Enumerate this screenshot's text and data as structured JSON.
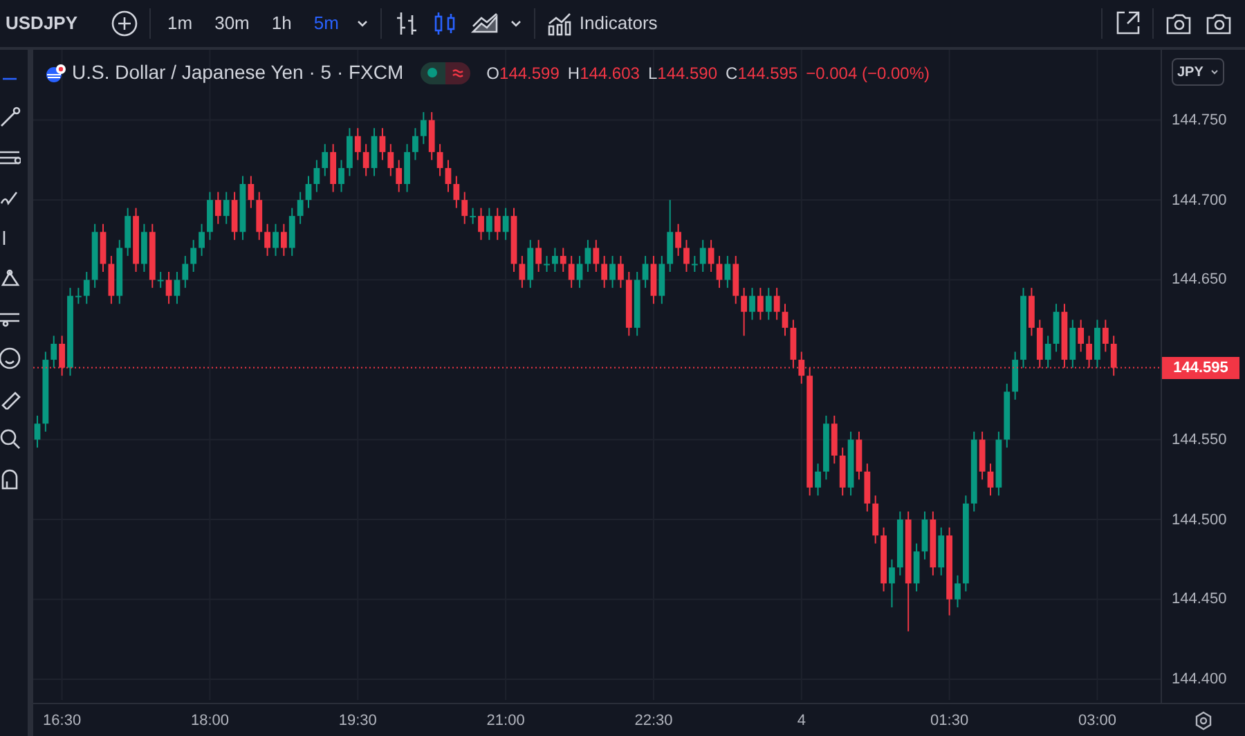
{
  "toolbar": {
    "symbol": "USDJPY",
    "intervals": [
      {
        "label": "1m",
        "selected": false
      },
      {
        "label": "30m",
        "selected": false
      },
      {
        "label": "1h",
        "selected": false
      },
      {
        "label": "5m",
        "selected": true
      }
    ],
    "chart_styles": [
      {
        "kind": "bars",
        "selected": false
      },
      {
        "kind": "candles",
        "selected": true
      },
      {
        "kind": "area",
        "selected": false
      }
    ],
    "indicators_label": "Indicators"
  },
  "legend": {
    "title": "U.S. Dollar / Japanese Yen · 5 · FXCM",
    "open_label": "O",
    "open": "144.599",
    "high_label": "H",
    "high": "144.603",
    "low_label": "L",
    "low": "144.590",
    "close_label": "C",
    "close": "144.595",
    "change": "−0.004 (−0.00%)"
  },
  "currency": "JPY",
  "next_day_time_labels": [
    "4",
    "01:30",
    "03:00"
  ],
  "last_price": "144.595",
  "chart": {
    "chart_data": {
      "type": "candlestick",
      "ylim": [
        144.387,
        144.794
      ],
      "yticks": [
        {
          "value": 144.4,
          "label": "144.400"
        },
        {
          "value": 144.45,
          "label": "144.450"
        },
        {
          "value": 144.5,
          "label": "144.500"
        },
        {
          "value": 144.55,
          "label": "144.550"
        },
        {
          "value": 144.65,
          "label": "144.650"
        },
        {
          "value": 144.7,
          "label": "144.700"
        },
        {
          "value": 144.75,
          "label": "144.750"
        }
      ],
      "grid": true,
      "ref_lines": [
        {
          "axis": "y",
          "value": 144.595,
          "color": "#f23645"
        }
      ],
      "xlim": [
        16.208,
        28.498
      ],
      "xticks": [
        {
          "value": 16.5,
          "label": "16:30"
        },
        {
          "value": 18,
          "label": "18:00"
        },
        {
          "value": 19.5,
          "label": "19:30"
        },
        {
          "value": 21,
          "label": "21:00"
        },
        {
          "value": 22.5,
          "label": "22:30"
        }
      ],
      "x": [
        16.25,
        16.3333,
        16.4167,
        16.5,
        16.5833,
        16.6667,
        16.75,
        16.8333,
        16.9167,
        17,
        17.0833,
        17.1667,
        17.25,
        17.3333,
        17.4167,
        17.5,
        17.5833,
        17.6667,
        17.75,
        17.8333,
        17.9167,
        18,
        18.0833,
        18.1667,
        18.25,
        18.3333,
        18.4167,
        18.5,
        18.5833,
        18.6667,
        18.75,
        18.8333,
        18.9167,
        19,
        19.0833,
        19.1667,
        19.25,
        19.3333,
        19.4167,
        19.5,
        19.5833,
        19.6667,
        19.75,
        19.8333,
        19.9167,
        20,
        20.0833,
        20.1667,
        20.25,
        20.3333,
        20.4167,
        20.5,
        20.5833,
        20.6667,
        20.75,
        20.8333,
        20.9167,
        21,
        21.0833,
        21.1667,
        21.25,
        21.3333,
        21.4167,
        21.5,
        21.5833,
        21.6667,
        21.75,
        21.8333,
        21.9167,
        22,
        22.0833,
        22.1667,
        22.25,
        22.3333,
        22.4167,
        22.5,
        22.5833,
        22.6667,
        22.75,
        22.8333,
        22.9167,
        23,
        23.0833,
        23.1667,
        23.25,
        23.3333,
        23.4167,
        23.5,
        23.5833,
        23.6667,
        23.75,
        23.8333,
        23.9167,
        24,
        24.0833,
        24.1667,
        24.25,
        24.3333,
        24.4167,
        24.5,
        24.5833,
        24.6667,
        24.75,
        24.8333,
        24.9167,
        25,
        25.0833,
        25.1667,
        25.25,
        25.3333,
        25.4167,
        25.5,
        25.5833,
        25.6667,
        25.75,
        25.8333,
        25.9167,
        26,
        26.0833,
        26.1667,
        26.25,
        26.3333,
        26.4167,
        26.5,
        26.5833,
        26.6667,
        26.75,
        26.8333,
        26.9167,
        27,
        27.0833,
        27.1667
      ],
      "ohlc": [
        [
          144.55,
          144.565,
          144.545,
          144.56
        ],
        [
          144.56,
          144.605,
          144.555,
          144.6
        ],
        [
          144.6,
          144.615,
          144.595,
          144.61
        ],
        [
          144.61,
          144.615,
          144.59,
          144.595
        ],
        [
          144.595,
          144.645,
          144.59,
          144.64
        ],
        [
          144.64,
          144.645,
          144.635,
          144.64
        ],
        [
          144.64,
          144.655,
          144.635,
          144.65
        ],
        [
          144.65,
          144.685,
          144.645,
          144.68
        ],
        [
          144.68,
          144.685,
          144.655,
          144.66
        ],
        [
          144.66,
          144.665,
          144.635,
          144.64
        ],
        [
          144.64,
          144.675,
          144.635,
          144.67
        ],
        [
          144.67,
          144.695,
          144.665,
          144.69
        ],
        [
          144.69,
          144.695,
          144.655,
          144.66
        ],
        [
          144.66,
          144.685,
          144.655,
          144.68
        ],
        [
          144.68,
          144.685,
          144.645,
          144.65
        ],
        [
          144.65,
          144.655,
          144.645,
          144.65
        ],
        [
          144.65,
          144.655,
          144.635,
          144.64
        ],
        [
          144.64,
          144.655,
          144.635,
          144.65
        ],
        [
          144.65,
          144.665,
          144.645,
          144.66
        ],
        [
          144.66,
          144.675,
          144.655,
          144.67
        ],
        [
          144.67,
          144.685,
          144.665,
          144.68
        ],
        [
          144.68,
          144.705,
          144.675,
          144.7
        ],
        [
          144.7,
          144.705,
          144.685,
          144.69
        ],
        [
          144.69,
          144.705,
          144.685,
          144.7
        ],
        [
          144.7,
          144.705,
          144.675,
          144.68
        ],
        [
          144.68,
          144.715,
          144.675,
          144.71
        ],
        [
          144.71,
          144.715,
          144.695,
          144.7
        ],
        [
          144.7,
          144.705,
          144.675,
          144.68
        ],
        [
          144.68,
          144.685,
          144.665,
          144.67
        ],
        [
          144.67,
          144.685,
          144.665,
          144.68
        ],
        [
          144.68,
          144.685,
          144.665,
          144.67
        ],
        [
          144.67,
          144.695,
          144.665,
          144.69
        ],
        [
          144.69,
          144.705,
          144.685,
          144.7
        ],
        [
          144.7,
          144.715,
          144.695,
          144.71
        ],
        [
          144.71,
          144.725,
          144.705,
          144.72
        ],
        [
          144.72,
          144.735,
          144.715,
          144.73
        ],
        [
          144.73,
          144.735,
          144.705,
          144.71
        ],
        [
          144.71,
          144.725,
          144.705,
          144.72
        ],
        [
          144.72,
          144.745,
          144.715,
          144.74
        ],
        [
          144.74,
          144.745,
          144.725,
          144.73
        ],
        [
          144.73,
          144.735,
          144.715,
          144.72
        ],
        [
          144.72,
          144.745,
          144.715,
          144.74
        ],
        [
          144.74,
          144.745,
          144.725,
          144.73
        ],
        [
          144.73,
          144.735,
          144.715,
          144.72
        ],
        [
          144.72,
          144.725,
          144.705,
          144.71
        ],
        [
          144.71,
          144.735,
          144.705,
          144.73
        ],
        [
          144.73,
          144.745,
          144.725,
          144.74
        ],
        [
          144.74,
          144.755,
          144.735,
          144.75
        ],
        [
          144.75,
          144.755,
          144.725,
          144.73
        ],
        [
          144.73,
          144.735,
          144.715,
          144.72
        ],
        [
          144.72,
          144.725,
          144.705,
          144.71
        ],
        [
          144.71,
          144.715,
          144.695,
          144.7
        ],
        [
          144.7,
          144.705,
          144.685,
          144.69
        ],
        [
          144.69,
          144.695,
          144.685,
          144.69
        ],
        [
          144.69,
          144.695,
          144.675,
          144.68
        ],
        [
          144.68,
          144.695,
          144.675,
          144.69
        ],
        [
          144.69,
          144.695,
          144.675,
          144.68
        ],
        [
          144.68,
          144.695,
          144.675,
          144.69
        ],
        [
          144.69,
          144.695,
          144.655,
          144.66
        ],
        [
          144.66,
          144.665,
          144.645,
          144.65
        ],
        [
          144.65,
          144.675,
          144.645,
          144.67
        ],
        [
          144.67,
          144.675,
          144.655,
          144.66
        ],
        [
          144.66,
          144.665,
          144.655,
          144.66
        ],
        [
          144.66,
          144.67,
          144.655,
          144.665
        ],
        [
          144.665,
          144.67,
          144.655,
          144.66
        ],
        [
          144.66,
          144.665,
          144.645,
          144.65
        ],
        [
          144.65,
          144.665,
          144.645,
          144.66
        ],
        [
          144.66,
          144.675,
          144.655,
          144.67
        ],
        [
          144.67,
          144.675,
          144.655,
          144.66
        ],
        [
          144.66,
          144.665,
          144.645,
          144.65
        ],
        [
          144.65,
          144.665,
          144.645,
          144.66
        ],
        [
          144.66,
          144.665,
          144.645,
          144.65
        ],
        [
          144.65,
          144.655,
          144.615,
          144.62
        ],
        [
          144.62,
          144.655,
          144.615,
          144.65
        ],
        [
          144.65,
          144.665,
          144.645,
          144.66
        ],
        [
          144.66,
          144.665,
          144.635,
          144.64
        ],
        [
          144.64,
          144.665,
          144.635,
          144.66
        ],
        [
          144.66,
          144.7,
          144.655,
          144.68
        ],
        [
          144.68,
          144.685,
          144.665,
          144.67
        ],
        [
          144.67,
          144.675,
          144.655,
          144.66
        ],
        [
          144.66,
          144.665,
          144.655,
          144.66
        ],
        [
          144.66,
          144.675,
          144.655,
          144.67
        ],
        [
          144.67,
          144.675,
          144.655,
          144.66
        ],
        [
          144.66,
          144.665,
          144.645,
          144.65
        ],
        [
          144.65,
          144.665,
          144.645,
          144.66
        ],
        [
          144.66,
          144.665,
          144.635,
          144.64
        ],
        [
          144.64,
          144.645,
          144.615,
          144.63
        ],
        [
          144.63,
          144.645,
          144.625,
          144.64
        ],
        [
          144.64,
          144.645,
          144.625,
          144.63
        ],
        [
          144.63,
          144.645,
          144.625,
          144.64
        ],
        [
          144.64,
          144.645,
          144.625,
          144.63
        ],
        [
          144.63,
          144.635,
          144.615,
          144.62
        ],
        [
          144.62,
          144.625,
          144.595,
          144.6
        ],
        [
          144.6,
          144.605,
          144.585,
          144.59
        ],
        [
          144.59,
          144.595,
          144.515,
          144.52
        ],
        [
          144.52,
          144.535,
          144.515,
          144.53
        ],
        [
          144.53,
          144.565,
          144.525,
          144.56
        ],
        [
          144.56,
          144.565,
          144.535,
          144.54
        ],
        [
          144.54,
          144.545,
          144.515,
          144.52
        ],
        [
          144.52,
          144.555,
          144.515,
          144.55
        ],
        [
          144.55,
          144.555,
          144.525,
          144.53
        ],
        [
          144.53,
          144.535,
          144.505,
          144.51
        ],
        [
          144.51,
          144.515,
          144.485,
          144.49
        ],
        [
          144.49,
          144.495,
          144.455,
          144.46
        ],
        [
          144.46,
          144.475,
          144.445,
          144.47
        ],
        [
          144.47,
          144.505,
          144.465,
          144.5
        ],
        [
          144.5,
          144.505,
          144.43,
          144.46
        ],
        [
          144.46,
          144.485,
          144.455,
          144.48
        ],
        [
          144.48,
          144.505,
          144.475,
          144.5
        ],
        [
          144.5,
          144.505,
          144.465,
          144.47
        ],
        [
          144.47,
          144.495,
          144.465,
          144.49
        ],
        [
          144.49,
          144.495,
          144.44,
          144.45
        ],
        [
          144.45,
          144.465,
          144.445,
          144.46
        ],
        [
          144.46,
          144.515,
          144.455,
          144.51
        ],
        [
          144.51,
          144.555,
          144.505,
          144.55
        ],
        [
          144.55,
          144.555,
          144.525,
          144.53
        ],
        [
          144.53,
          144.535,
          144.515,
          144.52
        ],
        [
          144.52,
          144.555,
          144.515,
          144.55
        ],
        [
          144.55,
          144.585,
          144.545,
          144.58
        ],
        [
          144.58,
          144.605,
          144.575,
          144.6
        ],
        [
          144.6,
          144.645,
          144.595,
          144.64
        ],
        [
          144.64,
          144.645,
          144.615,
          144.62
        ],
        [
          144.62,
          144.625,
          144.595,
          144.6
        ],
        [
          144.6,
          144.615,
          144.595,
          144.61
        ],
        [
          144.61,
          144.635,
          144.605,
          144.63
        ],
        [
          144.63,
          144.635,
          144.595,
          144.6
        ],
        [
          144.6,
          144.625,
          144.595,
          144.62
        ],
        [
          144.62,
          144.625,
          144.605,
          144.61
        ],
        [
          144.61,
          144.615,
          144.595,
          144.6
        ],
        [
          144.6,
          144.625,
          144.595,
          144.62
        ],
        [
          144.62,
          144.625,
          144.605,
          144.61
        ],
        [
          144.61,
          144.615,
          144.59,
          144.595
        ]
      ]
    }
  }
}
